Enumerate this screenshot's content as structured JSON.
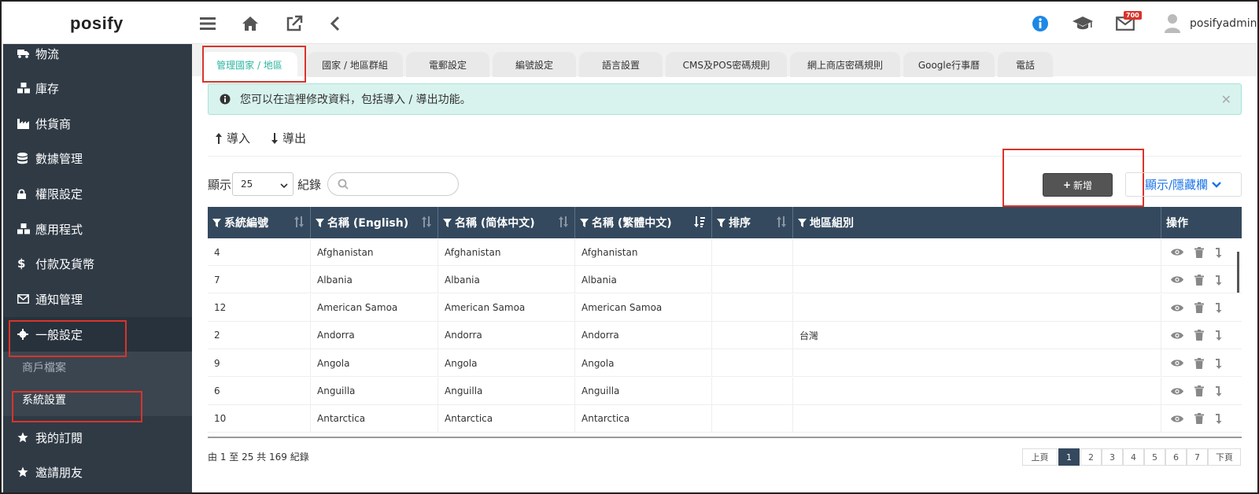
{
  "header": {
    "logo": "posify",
    "username": "posifyadmin",
    "mail_badge": "700"
  },
  "sidebar": {
    "items": [
      {
        "label": "物流",
        "icon": "truck-icon"
      },
      {
        "label": "庫存",
        "icon": "cubes-icon"
      },
      {
        "label": "供貨商",
        "icon": "industry-icon"
      },
      {
        "label": "數據管理",
        "icon": "database-icon"
      },
      {
        "label": "權限設定",
        "icon": "lock-icon"
      },
      {
        "label": "應用程式",
        "icon": "cubes-icon"
      },
      {
        "label": "付款及貨幣",
        "icon": "dollar-icon"
      },
      {
        "label": "通知管理",
        "icon": "envelope-icon"
      },
      {
        "label": "一般設定",
        "icon": "gear-icon"
      }
    ],
    "sub_items": [
      {
        "label": "商戶檔案"
      },
      {
        "label": "系統設置"
      }
    ],
    "bottom_items": [
      {
        "label": "我的訂閱",
        "icon": "star-icon"
      },
      {
        "label": "邀請朋友",
        "icon": "star-icon"
      }
    ]
  },
  "tabs": [
    {
      "label": "管理國家 / 地區",
      "active": true
    },
    {
      "label": "國家 / 地區群組"
    },
    {
      "label": "電郵設定"
    },
    {
      "label": "編號設定"
    },
    {
      "label": "語言設置"
    },
    {
      "label": "CMS及POS密碼規則"
    },
    {
      "label": "網上商店密碼規則"
    },
    {
      "label": "Google行事曆"
    },
    {
      "label": "電話"
    }
  ],
  "alert": {
    "text": "您可以在這裡修改資料，包括導入 / 導出功能。"
  },
  "toolbar": {
    "import_label": "導入",
    "export_label": "導出",
    "show_label": "顯示",
    "records_label": "紀錄",
    "page_size": "25",
    "add_label": "新增",
    "toggle_columns_label": "顯示/隱藏欄"
  },
  "table": {
    "headers": [
      "系統編號",
      "名稱 (English)",
      "名稱 (简体中文)",
      "名稱 (繁體中文)",
      "排序",
      "地區組別",
      "操作"
    ],
    "rows": [
      {
        "id": "4",
        "en": "Afghanistan",
        "sc": "Afghanistan",
        "tc": "Afghanistan",
        "sort": "",
        "group": ""
      },
      {
        "id": "7",
        "en": "Albania",
        "sc": "Albania",
        "tc": "Albania",
        "sort": "",
        "group": ""
      },
      {
        "id": "12",
        "en": "American Samoa",
        "sc": "American Samoa",
        "tc": "American Samoa",
        "sort": "",
        "group": ""
      },
      {
        "id": "2",
        "en": "Andorra",
        "sc": "Andorra",
        "tc": "Andorra",
        "sort": "",
        "group": "台灣"
      },
      {
        "id": "9",
        "en": "Angola",
        "sc": "Angola",
        "tc": "Angola",
        "sort": "",
        "group": ""
      },
      {
        "id": "6",
        "en": "Anguilla",
        "sc": "Anguilla",
        "tc": "Anguilla",
        "sort": "",
        "group": ""
      },
      {
        "id": "10",
        "en": "Antarctica",
        "sc": "Antarctica",
        "tc": "Antarctica",
        "sort": "",
        "group": ""
      }
    ]
  },
  "footer": {
    "info": "由 1 至 25 共 169 紀錄",
    "prev": "上頁",
    "next": "下頁",
    "pages": [
      "1",
      "2",
      "3",
      "4",
      "5",
      "6",
      "7"
    ],
    "current_page": "1"
  },
  "colors": {
    "sidebar_bg": "#2f3a45",
    "accent": "#2bb5a0",
    "header_table": "#34495e",
    "highlight": "#d9342b",
    "link": "#1a73e8"
  }
}
